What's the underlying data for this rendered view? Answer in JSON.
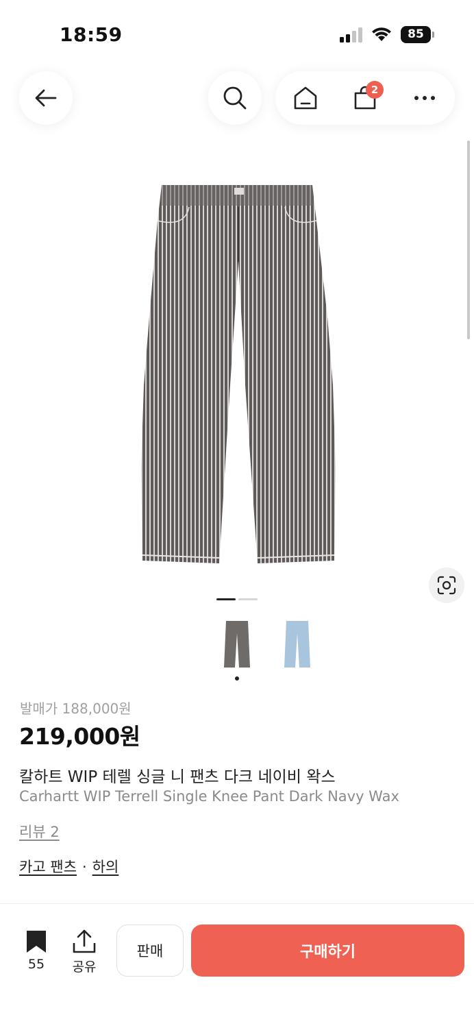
{
  "status_bar": {
    "time": "18:59",
    "battery": "85"
  },
  "nav": {
    "cart_count": "2"
  },
  "product": {
    "release_price": "발매가 188,000원",
    "price": "219,000원",
    "name_ko": "칼하트 WIP 테렐 싱글 니 팬츠 다크 네이비 왁스",
    "name_en": "Carhartt WIP Terrell Single Knee Pant Dark Navy Wax",
    "review": "리뷰 2",
    "category_1": "카고 팬츠",
    "category_sep": "·",
    "category_2": "하의",
    "colors": {
      "variant_1": "#6f6b69",
      "variant_2": "#a9c4dd"
    }
  },
  "bottom_bar": {
    "bookmark_count": "55",
    "share_label": "공유",
    "sell_label": "판매",
    "buy_label": "구매하기",
    "accent": "#ef6253"
  }
}
